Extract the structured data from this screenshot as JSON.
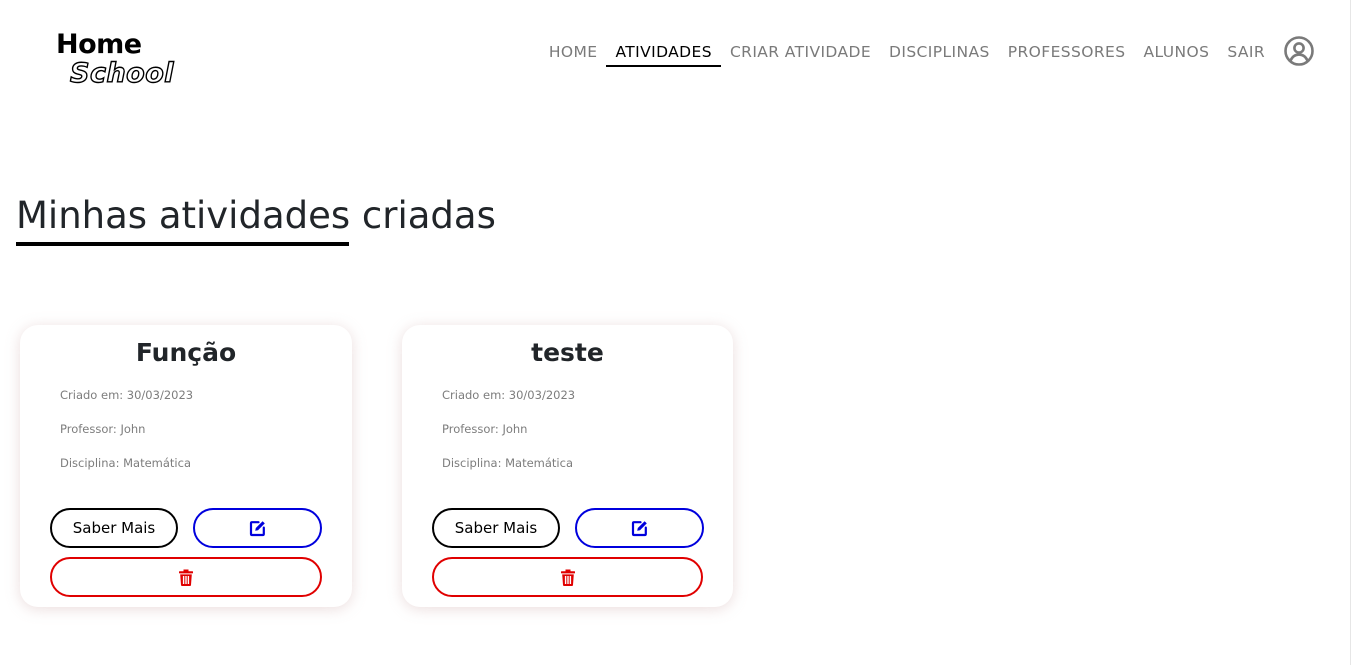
{
  "brand": {
    "line1": "Home",
    "line2": "School"
  },
  "nav": {
    "items": [
      {
        "label": "HOME",
        "active": false
      },
      {
        "label": "ATIVIDADES",
        "active": true
      },
      {
        "label": "CRIAR ATIVIDADE",
        "active": false
      },
      {
        "label": "DISCIPLINAS",
        "active": false
      },
      {
        "label": "PROFESSORES",
        "active": false
      },
      {
        "label": "ALUNOS",
        "active": false
      },
      {
        "label": "SAIR",
        "active": false
      }
    ],
    "user_icon": "user-circle-icon"
  },
  "page": {
    "title": "Minhas atividades criadas"
  },
  "cards": [
    {
      "title": "Função",
      "created": "Criado em: 30/03/2023",
      "teacher": "Professor: John",
      "subject": "Disciplina: Matemática",
      "more_label": "Saber Mais",
      "edit_icon": "edit-icon",
      "delete_icon": "trash-icon"
    },
    {
      "title": "teste",
      "created": "Criado em: 30/03/2023",
      "teacher": "Professor: John",
      "subject": "Disciplina: Matemática",
      "more_label": "Saber Mais",
      "edit_icon": "edit-icon",
      "delete_icon": "trash-icon"
    }
  ],
  "colors": {
    "edit_accent": "#0000dd",
    "delete_accent": "#e00000",
    "nav_text": "#7a7a7a",
    "nav_active": "#000000"
  }
}
